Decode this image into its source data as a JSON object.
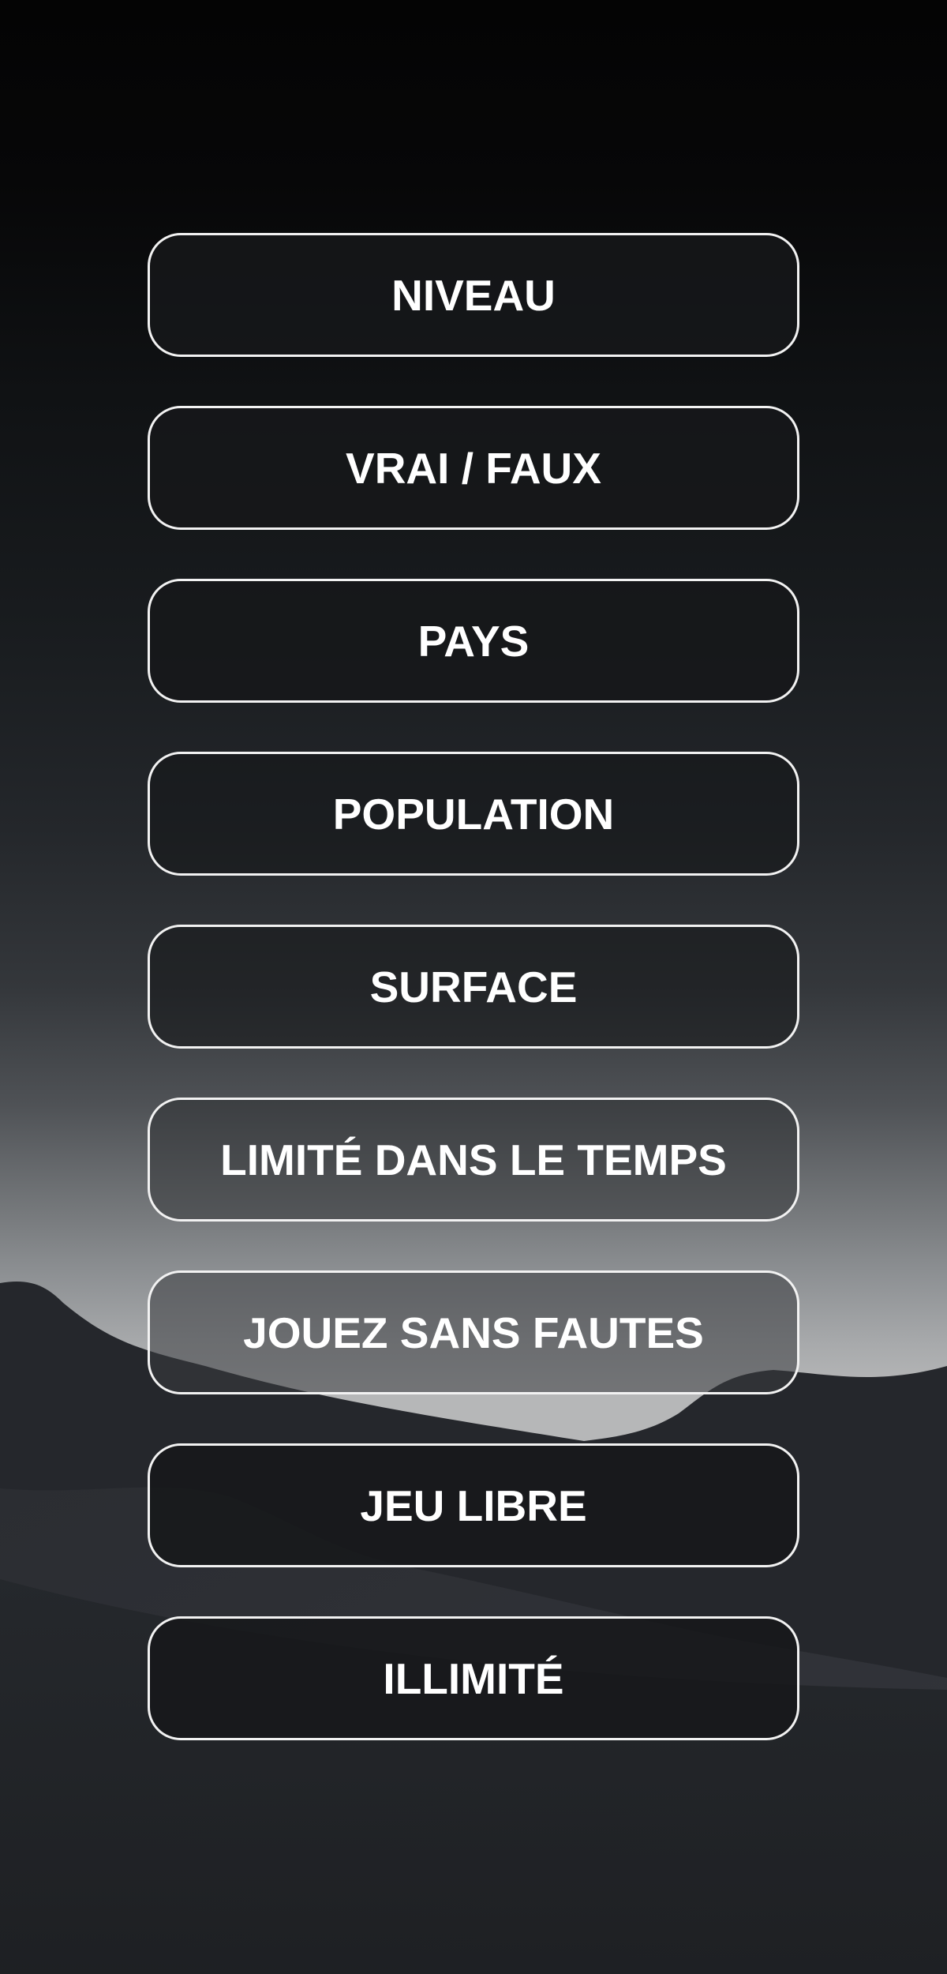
{
  "menu": {
    "items": [
      {
        "label": "NIVEAU"
      },
      {
        "label": "VRAI / FAUX"
      },
      {
        "label": "PAYS"
      },
      {
        "label": "POPULATION"
      },
      {
        "label": "SURFACE"
      },
      {
        "label": "LIMITÉ DANS LE TEMPS"
      },
      {
        "label": "JOUEZ SANS FAUTES"
      },
      {
        "label": "JEU LIBRE"
      },
      {
        "label": "ILLIMITÉ"
      }
    ]
  },
  "theme": {
    "button_border": "#f2f2f2",
    "button_text": "#ffffff",
    "sky_top": "#040404",
    "sky_horizon": "#b6b7b8",
    "hill_back": "#25272c",
    "hill_front": "#2c2e34",
    "ground": "#1c1e21"
  }
}
